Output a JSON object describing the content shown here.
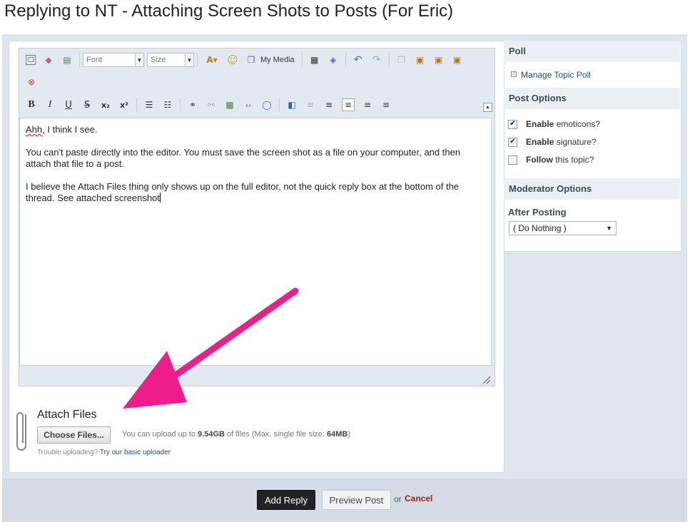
{
  "page_title": "Replying to NT - Attaching Screen Shots to Posts (For Eric)",
  "toolbar": {
    "font_combo": "Font",
    "size_combo": "Size",
    "my_media": "My Media"
  },
  "editor": {
    "lines": [
      "I think I see.",
      "You can't paste directly into the editor.  You must save the screen shot as a file on your computer, and then attach that file to a post.",
      "I believe the Attach Files thing only shows up on the full editor, not the quick reply box at the bottom of the thread.  See attached screenshot"
    ],
    "first_word": "Ahh,"
  },
  "attach": {
    "title": "Attach Files",
    "choose_button": "Choose Files...",
    "upload_prefix": "You can upload up to",
    "upload_size": "9.54GB",
    "upload_middle": "of files (Max. single file size:",
    "upload_max": "64MB",
    "upload_suffix": ")",
    "trouble_text": "Trouble uploading?",
    "basic_uploader_link": "Try our basic uploader"
  },
  "sidebar": {
    "poll_heading": "Poll",
    "manage_poll": "Manage Topic Poll",
    "post_options_heading": "Post Options",
    "options": [
      {
        "bold": "Enable",
        "rest": "emoticons?",
        "checked": true
      },
      {
        "bold": "Enable",
        "rest": "signature?",
        "checked": true
      },
      {
        "bold": "Follow",
        "rest": "this topic?",
        "checked": false
      }
    ],
    "moderator_heading": "Moderator Options",
    "after_posting_label": "After Posting",
    "after_posting_value": "( Do Nothing )"
  },
  "actions": {
    "add_reply": "Add Reply",
    "preview_post": "Preview Post",
    "or": "or",
    "cancel": "Cancel"
  },
  "colors": {
    "arrow": "#ee1d8c",
    "cancel": "#b0181e",
    "link": "#244d78"
  }
}
